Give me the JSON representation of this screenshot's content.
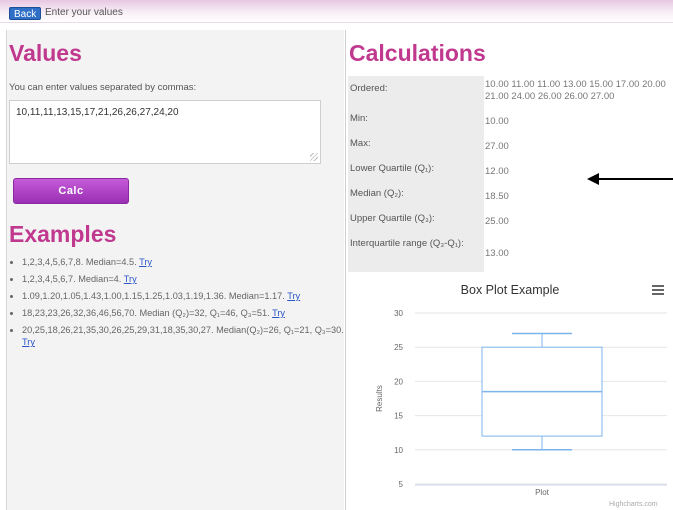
{
  "topbar": {
    "back_label": "Back",
    "title": "Enter your values"
  },
  "values": {
    "heading": "Values",
    "hint": "You can enter values separated by commas:",
    "input_value": "10,11,11,13,15,17,21,26,26,27,24,20",
    "calc_label": "Calc"
  },
  "examples": {
    "heading": "Examples",
    "items": [
      {
        "text": "1,2,3,4,5,6,7,8. Median=4.5.",
        "link": "Try"
      },
      {
        "text": "1,2,3,4,5,6,7. Median=4.",
        "link": "Try"
      },
      {
        "text": "1.09,1.20,1.05,1.43,1.00,1.15,1.25,1.03,1.19,1.36. Median=1.17.",
        "link": "Try"
      },
      {
        "text": "18,23,23,26,32,36,46,56,70. Median (Q₂)=32, Q₁=46, Q₃=51.",
        "link": "Try"
      },
      {
        "text": "20,25,18,26,21,35,30,26,25,29,31,18,35,30,27. Median(Q₂)=26, Q₁=21, Q₃=30.",
        "link": "Try"
      }
    ]
  },
  "calculations": {
    "heading": "Calculations",
    "rows": [
      {
        "label": "Ordered:",
        "value": "10.00 11.00 11.00 13.00 15.00 17.00 20.00 21.00 24.00 26.00 26.00 27.00"
      },
      {
        "label": "Min:",
        "value": "10.00"
      },
      {
        "label": "Max:",
        "value": "27.00"
      },
      {
        "label": "Lower Quartile (Q₁):",
        "value": "12.00"
      },
      {
        "label": "Median (Q₂):",
        "value": "18.50"
      },
      {
        "label": "Upper Quartile (Q₃):",
        "value": "25.00"
      },
      {
        "label": "Interquartile range (Q₃-Q₁):",
        "value": "13.00"
      }
    ]
  },
  "chart_data": {
    "type": "box",
    "title": "Box Plot Example",
    "categories": [
      "Plot"
    ],
    "ylabel": "Results",
    "xlabel": "",
    "ylim": [
      5,
      30
    ],
    "yticks": [
      5,
      10,
      15,
      20,
      25,
      30
    ],
    "series": [
      {
        "low": 10,
        "q1": 12,
        "median": 18.5,
        "q3": 25,
        "high": 27
      }
    ],
    "credits": "Highcharts.com",
    "colors": {
      "box": "#7cb5ec",
      "grid": "#e6e6e6"
    }
  }
}
